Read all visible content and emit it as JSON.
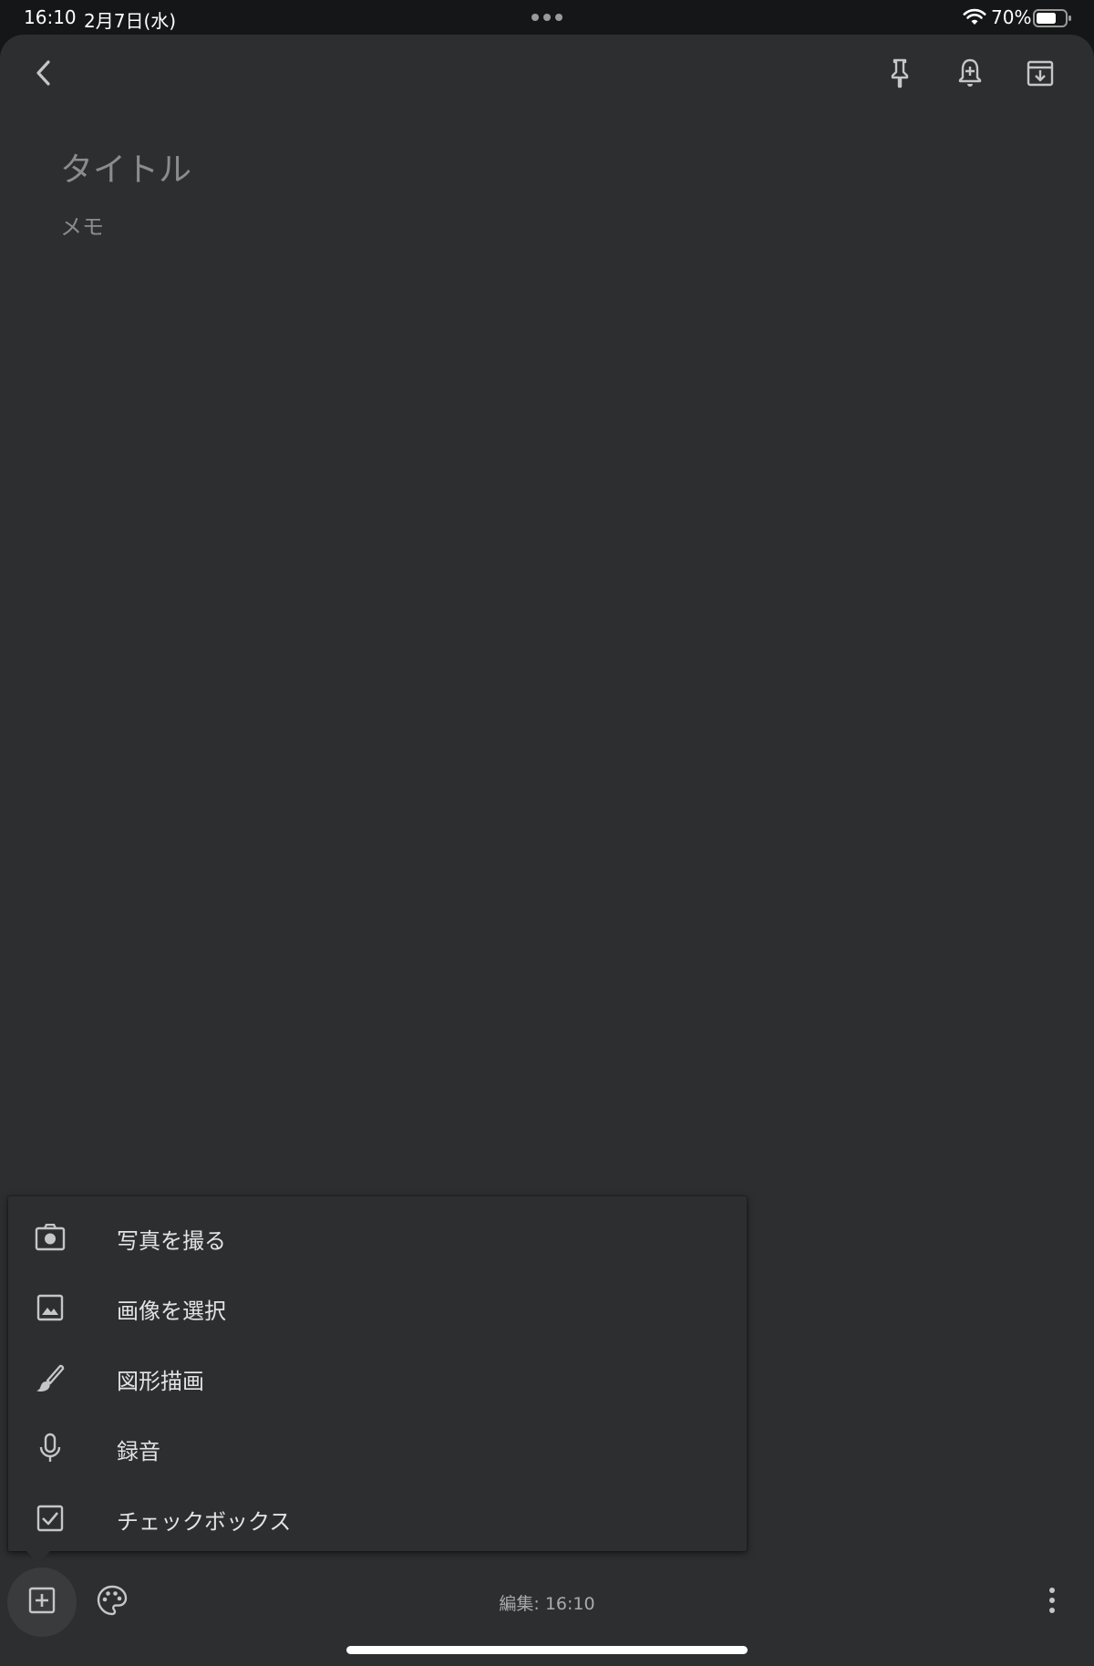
{
  "status_bar": {
    "time": "16:10",
    "date": "2月7日(水)",
    "battery_percent": "70%",
    "battery_level": 0.7,
    "wifi_icon": "wifi-icon",
    "battery_icon": "battery-icon"
  },
  "toolbar": {
    "back_icon": "chevron-left-icon",
    "pin_icon": "pin-icon",
    "reminder_icon": "add-alert-bell-icon",
    "archive_icon": "archive-icon"
  },
  "note": {
    "title_placeholder": "タイトル",
    "body_placeholder": "メモ"
  },
  "add_menu": {
    "items": [
      {
        "label": "写真を撮る",
        "icon": "camera-icon"
      },
      {
        "label": "画像を選択",
        "icon": "image-icon"
      },
      {
        "label": "図形描画",
        "icon": "brush-icon"
      },
      {
        "label": "録音",
        "icon": "microphone-icon"
      },
      {
        "label": "チェックボックス",
        "icon": "checkbox-icon"
      }
    ]
  },
  "bottom_bar": {
    "add_icon": "add-box-icon",
    "palette_icon": "palette-icon",
    "edited_text": "編集: 16:10",
    "more_icon": "more-vertical-icon"
  },
  "colors": {
    "background": "#2d2e30",
    "status_bar": "#151617",
    "icon": "#c4c7c5",
    "placeholder": "#8b8c8e",
    "menu_text": "#e3e3e3"
  }
}
